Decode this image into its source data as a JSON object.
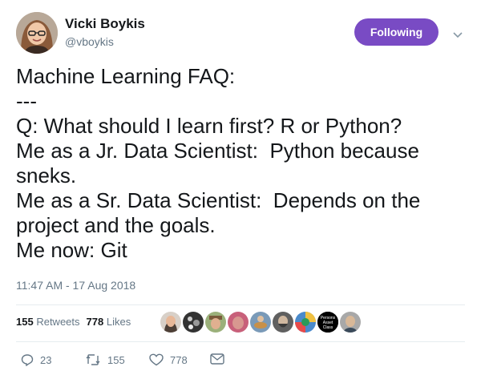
{
  "author": {
    "display_name": "Vicki Boykis",
    "handle": "@vboykis"
  },
  "follow_button": {
    "label": "Following",
    "color": "#794bc4"
  },
  "tweet": {
    "lines": [
      "Machine Learning FAQ:",
      "---",
      "Q: What should I learn first? R or Python?",
      "Me as a Jr. Data Scientist:  Python because",
      "sneks.",
      "Me as a Sr. Data Scientist:  Depends on the",
      "project and the goals.",
      "Me now: Git"
    ],
    "timestamp": "11:47 AM - 17 Aug 2018"
  },
  "stats": {
    "retweets_count": "155",
    "retweets_label": "Retweets",
    "likes_count": "778",
    "likes_label": "Likes"
  },
  "likers": [
    {
      "icon": "avatar-woman"
    },
    {
      "icon": "avatar-dark-pattern"
    },
    {
      "icon": "avatar-man-hat"
    },
    {
      "icon": "avatar-pink"
    },
    {
      "icon": "avatar-guitar"
    },
    {
      "icon": "avatar-beard"
    },
    {
      "icon": "avatar-colorful"
    },
    {
      "icon": "avatar-persons-asset-class",
      "text": "Persons Asset Class"
    },
    {
      "icon": "avatar-man"
    }
  ],
  "actions": {
    "reply_count": "23",
    "retweet_count": "155",
    "like_count": "778",
    "icons": [
      "reply-icon",
      "retweet-icon",
      "heart-icon",
      "message-icon"
    ]
  },
  "colors": {
    "text": "#14171a",
    "secondary": "#657786",
    "divider": "#e6ecf0"
  }
}
